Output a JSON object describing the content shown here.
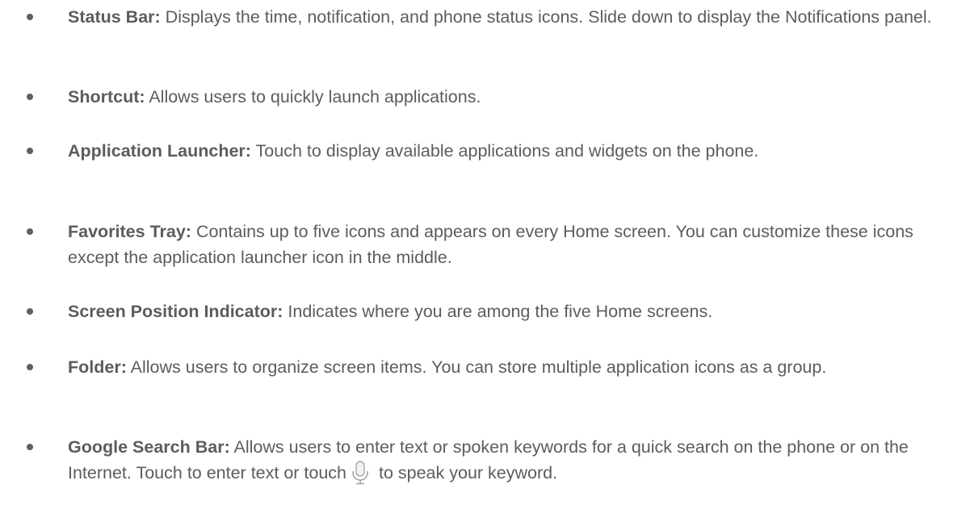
{
  "items": [
    {
      "term": "Status Bar:",
      "description": " Displays the time, notification, and phone status icons. Slide down to display the Notifications panel."
    },
    {
      "term": "Shortcut:",
      "description": " Allows users to quickly launch applications."
    },
    {
      "term": "Application Launcher:",
      "description": " Touch to display available applications and widgets on the phone."
    },
    {
      "term": "Favorites Tray:",
      "description": " Contains up to five icons and appears on every Home screen. You can customize these icons except the application launcher icon in the middle."
    },
    {
      "term": "Screen Position Indicator:",
      "description": " Indicates where you are among the five Home screens."
    },
    {
      "term": "Folder:",
      "description": " Allows users to organize screen items. You can store multiple application icons as a group."
    },
    {
      "term": "Google Search Bar:",
      "description_before_icon": " Allows users to enter text or spoken keywords for a quick search on the phone or on the Internet. Touch to enter text or touch",
      "icon": "microphone-icon",
      "description_after_icon": " to speak your keyword."
    }
  ]
}
